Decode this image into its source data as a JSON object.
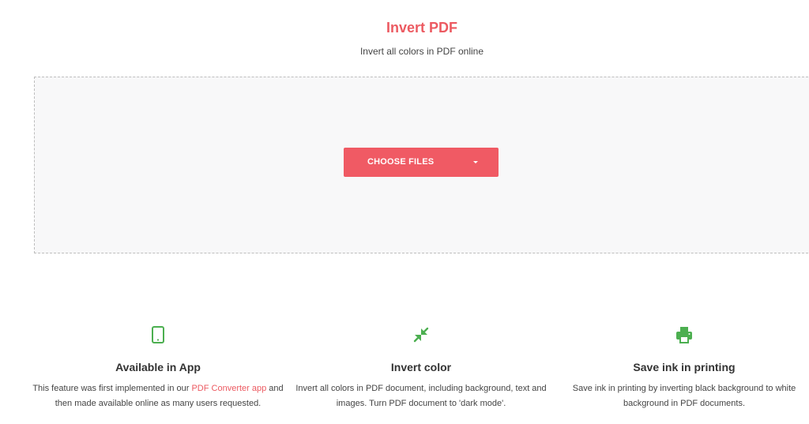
{
  "header": {
    "title": "Invert PDF",
    "subtitle": "Invert all colors in PDF online"
  },
  "upload": {
    "button_label": "CHOOSE FILES",
    "dropdown_icon": "caret-down-icon"
  },
  "features": [
    {
      "icon": "tablet-icon",
      "title": "Available in App",
      "desc_before": "This feature was first implemented in our ",
      "link_text": "PDF Converter app",
      "desc_after": " and then made available online as many users requested."
    },
    {
      "icon": "compress-arrows-icon",
      "title": "Invert color",
      "desc": "Invert all colors in PDF document, including background, text and images. Turn PDF document to 'dark mode'."
    },
    {
      "icon": "printer-icon",
      "title": "Save ink in printing",
      "desc": "Save ink in printing by inverting black background to white background in PDF documents."
    }
  ],
  "colors": {
    "accent": "#ec5a61",
    "button": "#f05a64",
    "icon_green": "#4caf50",
    "dropzone_bg": "#f8f8f9"
  }
}
